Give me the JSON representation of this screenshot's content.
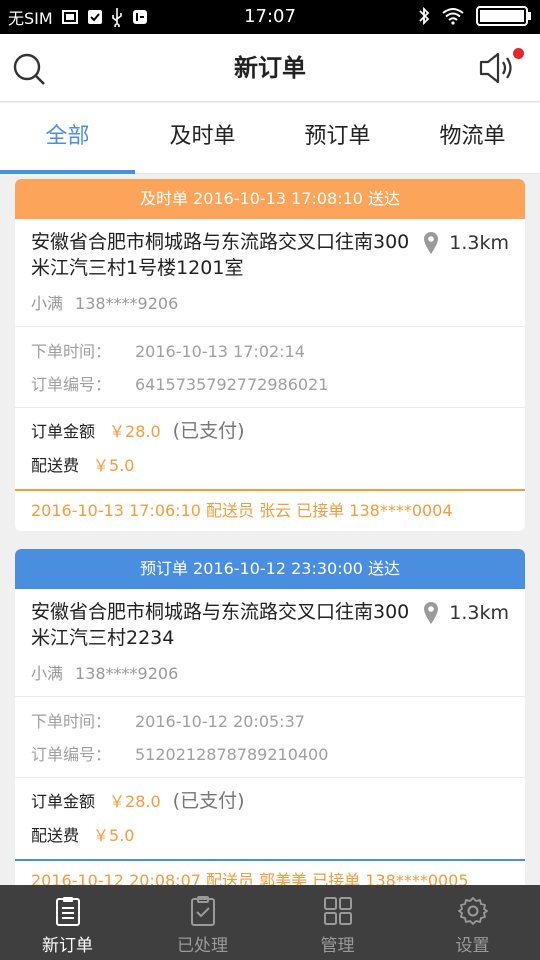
{
  "status_bar": {
    "carrier": "无SIM",
    "time": "17:07"
  },
  "header": {
    "title": "新订单",
    "notification_dot_color": "#e8242c"
  },
  "tabs": [
    {
      "label": "全部",
      "active": true
    },
    {
      "label": "及时单",
      "active": false
    },
    {
      "label": "预订单",
      "active": false
    },
    {
      "label": "物流单",
      "active": false
    }
  ],
  "accent_color": "#4a90e2",
  "orders": [
    {
      "banner": "及时单 2016-10-13 17:08:10 送达",
      "banner_color": "#fba45a",
      "address": "安徽省合肥市桐城路与东流路交叉口往南300米江汽三村1号楼1201室",
      "distance": "1.3km",
      "customer_name": "小满",
      "customer_phone": "138****9206",
      "order_time_label": "下单时间：",
      "order_time": "2016-10-13 17:02:14",
      "order_no_label": "订单编号：",
      "order_no": "6415735792772986021",
      "amount_label": "订单金额",
      "amount": "￥28.0",
      "paid_status": "(已支付)",
      "delivery_fee_label": "配送费",
      "delivery_fee": "￥5.0",
      "footer": "2016-10-13 17:06:10 配送员 张云 已接单 138****0004"
    },
    {
      "banner": "预订单 2016-10-12 23:30:00 送达",
      "banner_color": "#4a8ee0",
      "address": "安徽省合肥市桐城路与东流路交叉口往南300米江汽三村2234",
      "distance": "1.3km",
      "customer_name": "小满",
      "customer_phone": "138****9206",
      "order_time_label": "下单时间：",
      "order_time": "2016-10-12 20:05:37",
      "order_no_label": "订单编号：",
      "order_no": "5120212878789210400",
      "amount_label": "订单金额",
      "amount": "￥28.0",
      "paid_status": "(已支付)",
      "delivery_fee_label": "配送费",
      "delivery_fee": "￥5.0",
      "footer": "2016-10-12 20:08:07 配送员 郭美美 已接单 138****0005"
    }
  ],
  "bottom_nav": [
    {
      "label": "新订单",
      "icon": "clipboard-list-icon",
      "active": true
    },
    {
      "label": "已处理",
      "icon": "clipboard-check-icon",
      "active": false
    },
    {
      "label": "管理",
      "icon": "grid-icon",
      "active": false
    },
    {
      "label": "设置",
      "icon": "gear-icon",
      "active": false
    }
  ]
}
